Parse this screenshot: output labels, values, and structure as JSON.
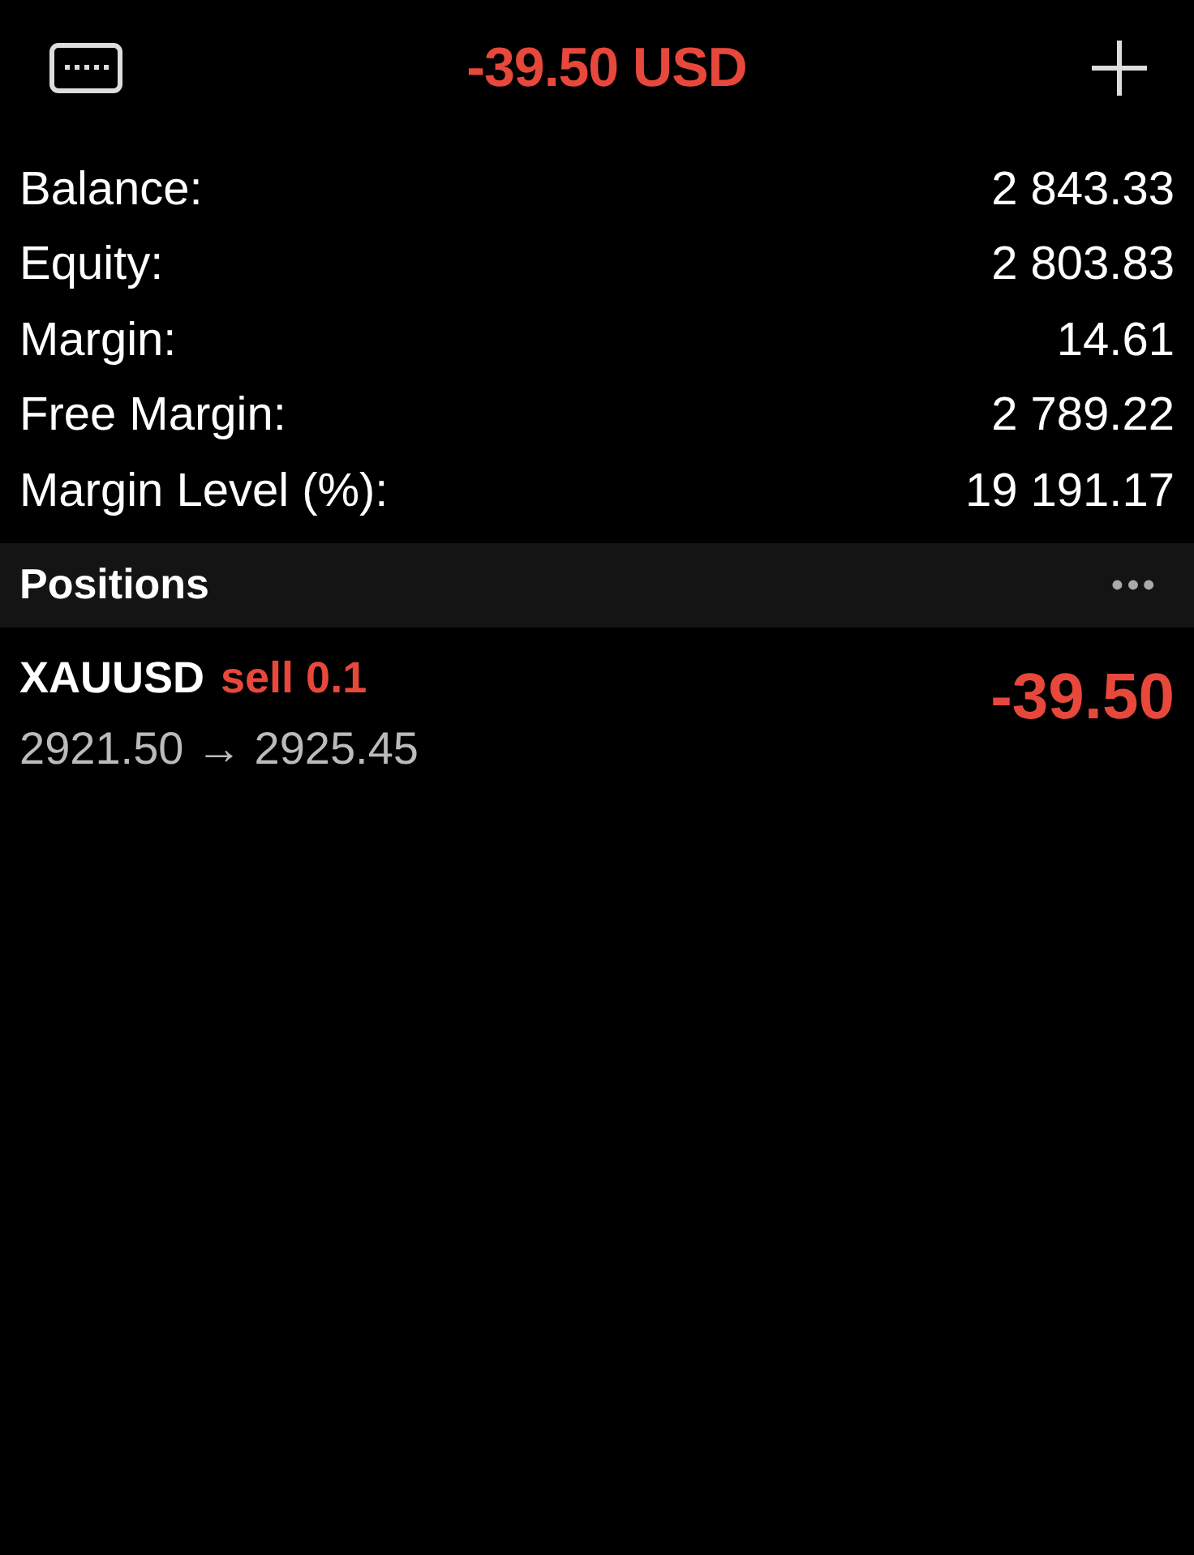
{
  "header": {
    "title": "-39.50 USD"
  },
  "summary": [
    {
      "label": "Balance:",
      "value": "2 843.33"
    },
    {
      "label": "Equity:",
      "value": "2 803.83"
    },
    {
      "label": "Margin:",
      "value": "14.61"
    },
    {
      "label": "Free Margin:",
      "value": "2 789.22"
    },
    {
      "label": "Margin Level (%):",
      "value": "19 191.17"
    }
  ],
  "positions_header": {
    "title": "Positions",
    "menu": "•••"
  },
  "positions": [
    {
      "symbol": "XAUUSD",
      "side": "sell 0.1",
      "prices": "2921.50 → 2925.45",
      "profit": "-39.50"
    }
  ]
}
